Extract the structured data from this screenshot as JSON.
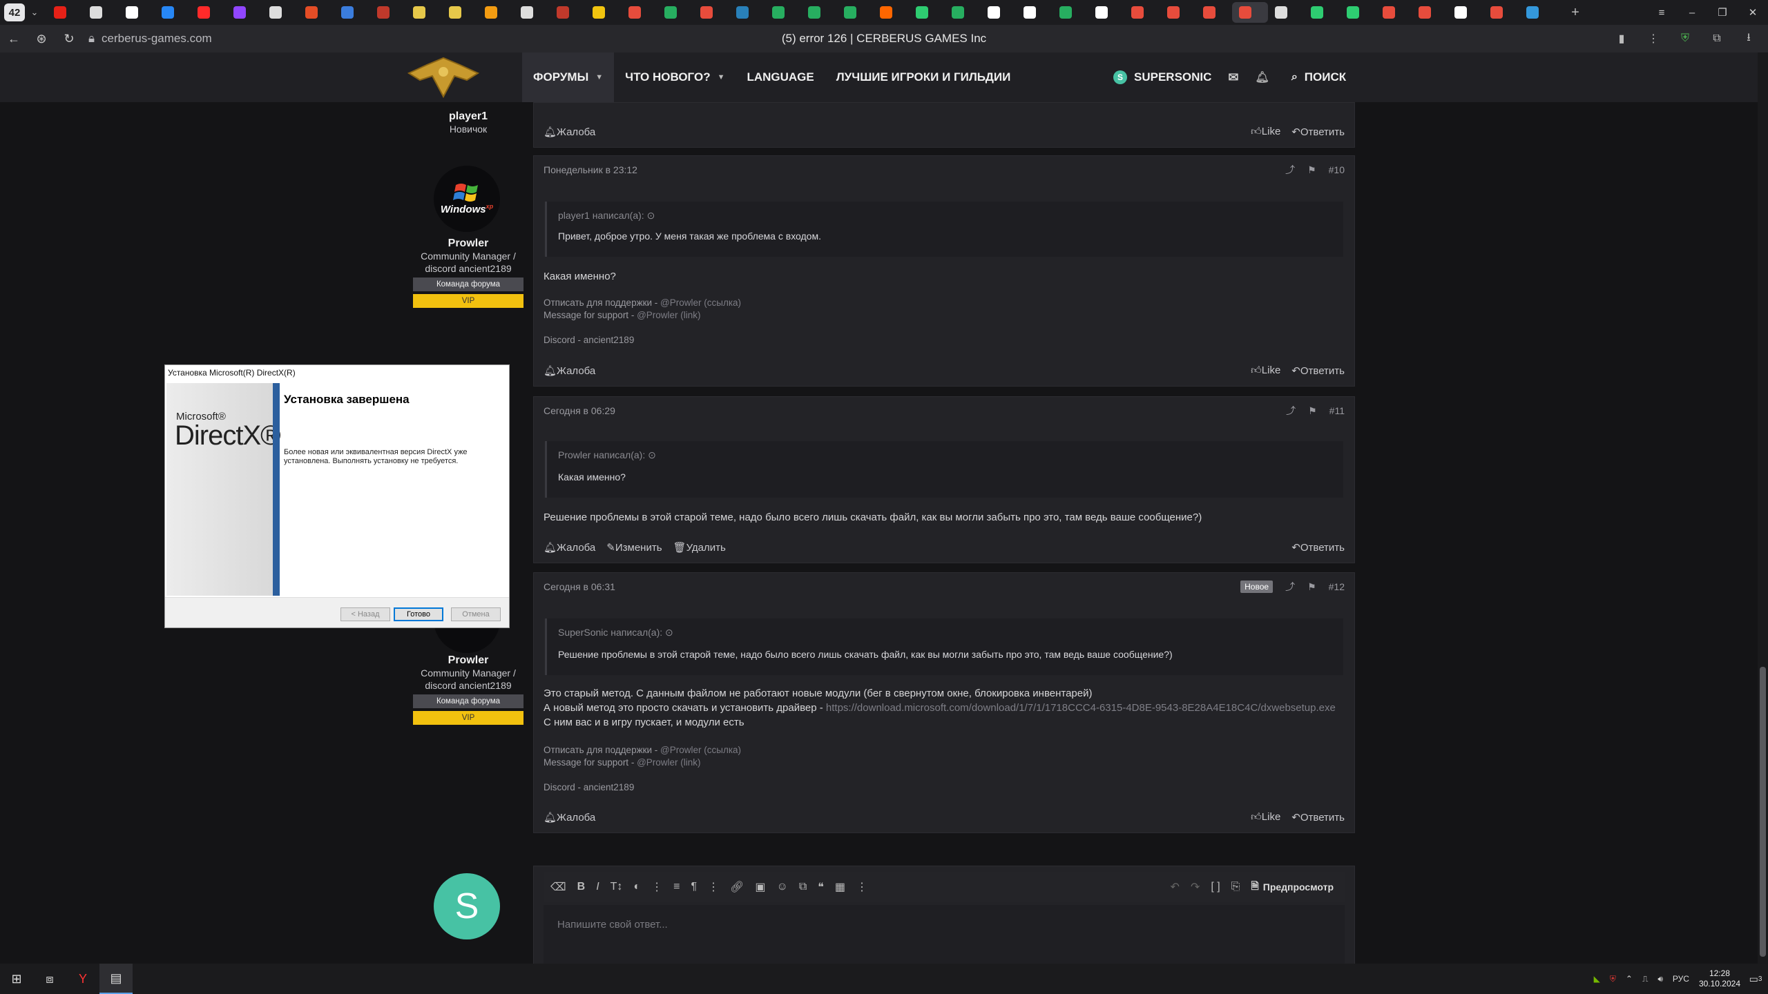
{
  "browser": {
    "tab_count": "42",
    "url": "cerberus-games.com",
    "title": "(5) error 126 | CERBERUS GAMES Inc",
    "tabs": [
      {
        "color": "#e62117"
      },
      {
        "color": "#dddddd"
      },
      {
        "color": "#ffffff"
      },
      {
        "color": "#2787f5"
      },
      {
        "color": "#ff2a2a"
      },
      {
        "color": "#9146ff"
      },
      {
        "color": "#dddddd"
      },
      {
        "color": "#e44d26"
      },
      {
        "color": "#3b7ddd"
      },
      {
        "color": "#c0392b"
      },
      {
        "color": "#e6c84a"
      },
      {
        "color": "#e6c84a"
      },
      {
        "color": "#f39c12"
      },
      {
        "color": "#dddddd"
      },
      {
        "color": "#c0392b"
      },
      {
        "color": "#f1c40f"
      },
      {
        "color": "#e74c3c"
      },
      {
        "color": "#27ae60"
      },
      {
        "color": "#e74c3c"
      },
      {
        "color": "#2980b9"
      },
      {
        "color": "#27ae60"
      },
      {
        "color": "#27ae60"
      },
      {
        "color": "#27ae60"
      },
      {
        "color": "#ff6600"
      },
      {
        "color": "#2ecc71"
      },
      {
        "color": "#27ae60"
      },
      {
        "color": "#ffffff"
      },
      {
        "color": "#ffffff"
      },
      {
        "color": "#27ae60"
      },
      {
        "color": "#ffffff"
      },
      {
        "color": "#e74c3c"
      },
      {
        "color": "#e74c3c"
      },
      {
        "color": "#e74c3c"
      },
      {
        "color": "#e74c3c"
      },
      {
        "color": "#dddddd"
      },
      {
        "color": "#2ecc71"
      },
      {
        "color": "#2ecc71"
      },
      {
        "color": "#e74c3c"
      },
      {
        "color": "#e74c3c"
      },
      {
        "color": "#ffffff"
      },
      {
        "color": "#e74c3c"
      },
      {
        "color": "#3498db"
      }
    ]
  },
  "nav": {
    "items": [
      "ФОРУМЫ",
      "ЧТО НОВОГО?",
      "LANGUAGE",
      "ЛУЧШИЕ ИГРОКИ И ГИЛЬДИИ"
    ],
    "user": "SUPERSONIC",
    "user_initial": "S",
    "search": "ПОИСК"
  },
  "sidebar": {
    "top_user": {
      "name": "player1",
      "title": "Новичок"
    },
    "prowler": {
      "name": "Prowler",
      "title_line1": "Community Manager /",
      "title_line2": "discord ancient2189",
      "badge_team": "Команда форума",
      "badge_vip": "VIP",
      "avatar_text": "Windows",
      "avatar_xp": "xp"
    }
  },
  "actions": {
    "report": "Жалоба",
    "like": "Like",
    "reply": "Ответить",
    "edit": "Изменить",
    "delete": "Удалить"
  },
  "posts": {
    "p10": {
      "date": "Понедельник в 23:12",
      "num": "#10",
      "quote_author": "player1 написал(а):",
      "quote_text": "Привет, доброе утро. У меня такая же проблема с входом.",
      "body": "Какая именно?",
      "sig1_text": "Отписать для поддержки - ",
      "sig1_link": "@Prowler (ссылка)",
      "sig2_text": "Message for support - ",
      "sig2_link": "@Prowler (link)",
      "sig3": "Discord - ancient2189"
    },
    "p11": {
      "date": "Сегодня в 06:29",
      "num": "#11",
      "quote_author": "Prowler написал(а):",
      "quote_text": "Какая именно?",
      "body": "Решение проблемы в этой старой теме, надо было всего лишь скачать файл, как вы могли забыть про это, там ведь ваше сообщение?)"
    },
    "p12": {
      "date": "Сегодня в 06:31",
      "badge": "Новое",
      "num": "#12",
      "quote_author": "SuperSonic написал(а):",
      "quote_text": "Решение проблемы в этой старой теме, надо было всего лишь скачать файл, как вы могли забыть про это, там ведь ваше сообщение?)",
      "line1": "Это старый метод. С данным файлом не работают новые модули (бег в свернутом окне, блокировка инвентарей)",
      "line2_text": "А новый метод это просто скачать и установить драйвер - ",
      "line2_link": "https://download.microsoft.com/download/1/7/1/1718CCC4-6315-4D8E-9543-8E28A4E18C4C/dxwebsetup.exe",
      "line3": "С ним вас и в игру пускает, и модули есть",
      "sig1_text": "Отписать для поддержки - ",
      "sig1_link": "@Prowler (ссылка)",
      "sig2_text": "Message for support - ",
      "sig2_link": "@Prowler (link)",
      "sig3": "Discord - ancient2189"
    }
  },
  "editor": {
    "placeholder": "Напишите свой ответ...",
    "preview": "Предпросмотр"
  },
  "dialog": {
    "title": "Установка Microsoft(R) DirectX(R)",
    "brand_ms": "Microsoft®",
    "brand_dx": "DirectX®",
    "heading": "Установка завершена",
    "message": "Более новая или эквивалентная версия DirectX уже установлена. Выполнять установку не требуется.",
    "btn_back": "< Назад",
    "btn_done": "Готово",
    "btn_cancel": "Отмена"
  },
  "taskbar": {
    "lang": "РУС",
    "time": "12:28",
    "date": "30.10.2024",
    "notifications": "3"
  },
  "colors": {
    "accent_green": "#47c2a4",
    "vip_yellow": "#f2c10f",
    "dx_blue": "#2c5f9e"
  }
}
